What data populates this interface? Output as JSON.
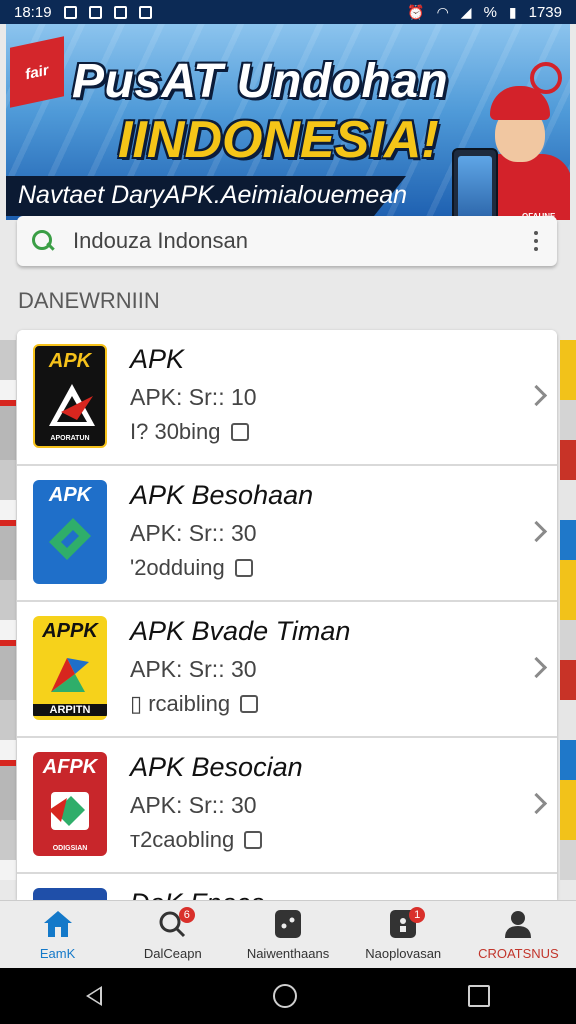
{
  "status_bar": {
    "time": "18:19",
    "battery_text": "1739",
    "percent": "%"
  },
  "banner": {
    "flag_text": "fair",
    "title_line1": "PusAT Undohan",
    "title_line2": "IINDONESIA!",
    "subtitle": "Navtaet DaryAPK.Aeimialouemean",
    "mascot_text": "OFAUNE"
  },
  "search": {
    "placeholder": "Indouza Indonsan"
  },
  "section_header": "DANEWRNIIN",
  "apps": [
    {
      "name": "APK",
      "meta": "APK: Sr:: 10",
      "status": "I? 30bing",
      "icon_label": "APK",
      "icon_foot": "APORATUN",
      "icon_bg": "#111111",
      "icon_label_color": "#f6c21b"
    },
    {
      "name": "APK Besohaan",
      "meta": "APK: Sr:: 30",
      "status": "'2odduing",
      "icon_label": "APK",
      "icon_foot": "",
      "icon_bg": "#1f6fc9",
      "icon_label_color": "#ffffff"
    },
    {
      "name": "APK Bvade Timan",
      "meta": "APK: Sr:: 30",
      "status": "▯ rcaibling",
      "icon_label": "APPK",
      "icon_foot": "ARPITN",
      "icon_bg": "#f6d21b",
      "icon_label_color": "#111111"
    },
    {
      "name": "APK Besocian",
      "meta": "APK: Sr:: 30",
      "status": "т2caobling",
      "icon_label": "AFPK",
      "icon_foot": "ODIGSIAN",
      "icon_bg": "#c8262b",
      "icon_label_color": "#ffffff"
    }
  ],
  "partial_app_name": "DaK Fnaca",
  "bottom_nav": [
    {
      "label": "EamK",
      "icon": "home-icon",
      "badge": ""
    },
    {
      "label": "DalCeapn",
      "icon": "search-icon",
      "badge": "6"
    },
    {
      "label": "Naiwenthaans",
      "icon": "apps-icon",
      "badge": ""
    },
    {
      "label": "Naoplovasan",
      "icon": "download-icon",
      "badge": "1"
    },
    {
      "label": "CROATSNUS",
      "icon": "profile-icon",
      "badge": ""
    }
  ],
  "colors": {
    "accent_blue": "#1479c9",
    "accent_red": "#d3222a",
    "accent_yellow": "#f5c518",
    "search_green": "#3a9e45"
  }
}
